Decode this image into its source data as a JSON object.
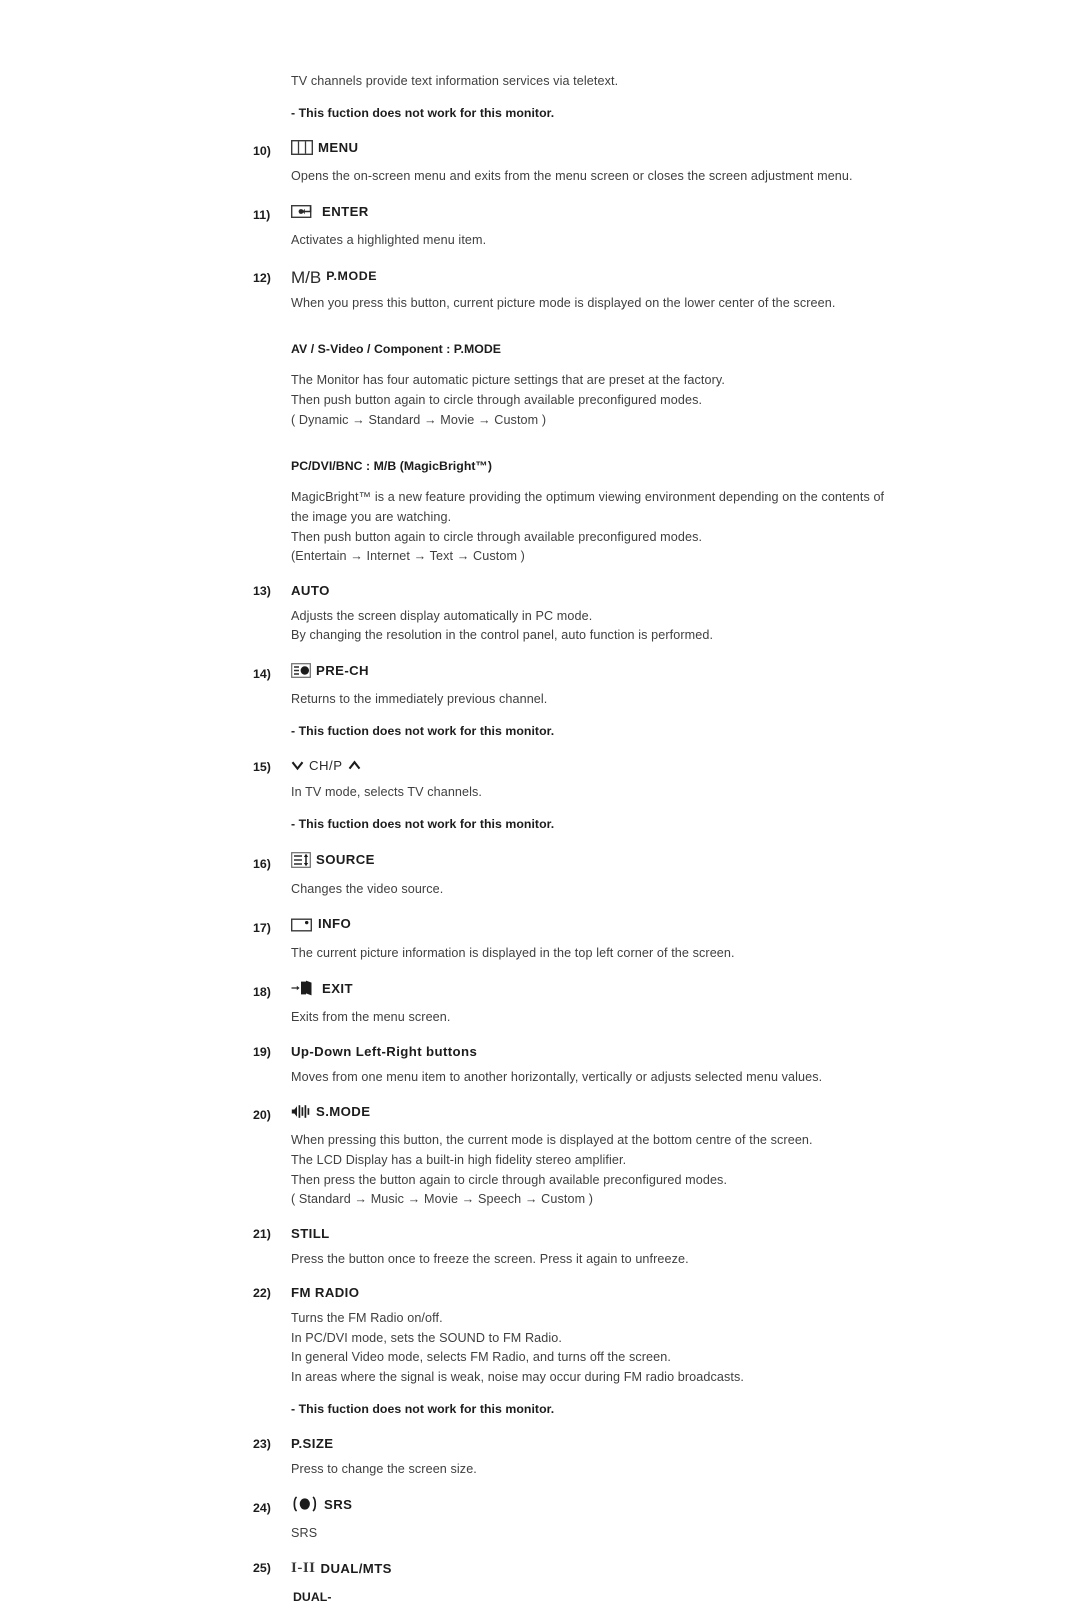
{
  "document": {
    "title": "Remote Control Button Descriptions",
    "text_color": "#3f3f3f",
    "heading_color": "#1c1c1c",
    "background": "#ffffff"
  },
  "intro": {
    "line": "TV channels provide text information services via teletext.",
    "note": "- This fuction does not work for this monitor."
  },
  "items": [
    {
      "num": "10)",
      "icon": "menu-icon",
      "label": "MENU",
      "body": [
        "Opens the on-screen menu and exits from the menu screen or closes the screen adjustment menu."
      ]
    },
    {
      "num": "11)",
      "icon": "enter-icon",
      "label": "ENTER",
      "body": [
        "Activates a highlighted menu item."
      ]
    },
    {
      "num": "12)",
      "icon": "mb-text-icon",
      "icon_text": "M/B",
      "label": "P.MODE",
      "body": [
        "When you press this button, current picture mode is displayed on the lower center of the screen."
      ],
      "sections": [
        {
          "heading": "AV / S-Video / Component : P.MODE",
          "lines": [
            "The Monitor has four automatic picture settings that are preset at the factory.",
            "Then push button again to circle through available preconfigured modes.",
            "( Dynamic → Standard → Movie → Custom )"
          ]
        },
        {
          "heading": "PC/DVI/BNC : M/B (MagicBright™)",
          "lines": [
            "MagicBright™ is a new feature providing the optimum viewing environment depending on the contents of",
            "the image you are watching.",
            "Then push button again to circle through available preconfigured modes.",
            "(Entertain → Internet → Text → Custom )"
          ]
        }
      ]
    },
    {
      "num": "13)",
      "icon": "none",
      "label": "AUTO",
      "body": [
        "Adjusts the screen display automatically in PC mode.",
        "By changing the resolution in the control panel, auto function is performed."
      ]
    },
    {
      "num": "14)",
      "icon": "pre-ch-icon",
      "label": "PRE-CH",
      "body": [
        "Returns to the immediately previous channel."
      ],
      "note": "- This fuction does not work for this monitor."
    },
    {
      "num": "15)",
      "icon": "ch-p-icon",
      "label": "CH/P",
      "body": [
        "In TV mode, selects TV channels."
      ],
      "note": "- This fuction does not work for this monitor."
    },
    {
      "num": "16)",
      "icon": "source-icon",
      "label": "SOURCE",
      "body": [
        "Changes the video source."
      ]
    },
    {
      "num": "17)",
      "icon": "info-icon",
      "label": "INFO",
      "body": [
        "The current picture information is displayed in the top left corner of the screen."
      ]
    },
    {
      "num": "18)",
      "icon": "exit-icon",
      "label": "EXIT",
      "body": [
        "Exits from the menu screen."
      ]
    },
    {
      "num": "19)",
      "icon": "none",
      "label": "Up-Down Left-Right buttons",
      "body": [
        "Moves from one menu item to another horizontally, vertically or adjusts selected menu values."
      ]
    },
    {
      "num": "20)",
      "icon": "s-mode-icon",
      "label": "S.MODE",
      "body": [
        "When pressing this button, the current mode is displayed at the bottom centre of the screen.",
        "The LCD Display has a built-in high fidelity stereo amplifier.",
        "Then press the button again to circle through available preconfigured modes.",
        "( Standard → Music → Movie → Speech → Custom )"
      ]
    },
    {
      "num": "21)",
      "icon": "none",
      "label": "STILL",
      "body": [
        "Press the button once to freeze the screen. Press it again to unfreeze."
      ]
    },
    {
      "num": "22)",
      "icon": "none",
      "label": "FM RADIO",
      "body": [
        "Turns the FM Radio on/off.",
        "In PC/DVI mode, sets the SOUND to FM Radio.",
        "In general Video mode, selects FM Radio, and turns off the screen.",
        "In areas where the signal is weak, noise may occur during FM radio broadcasts."
      ],
      "note": "- This fuction does not work for this monitor."
    },
    {
      "num": "23)",
      "icon": "none",
      "label": "P.SIZE",
      "body": [
        "Press to change the screen size."
      ]
    },
    {
      "num": "24)",
      "icon": "srs-icon",
      "label": "SRS",
      "body": [
        "SRS"
      ]
    },
    {
      "num": "25)",
      "icon": "dual-mts-icon",
      "icon_text": "I-II",
      "label": "DUAL/MTS",
      "body": [
        "DUAL-"
      ]
    }
  ]
}
